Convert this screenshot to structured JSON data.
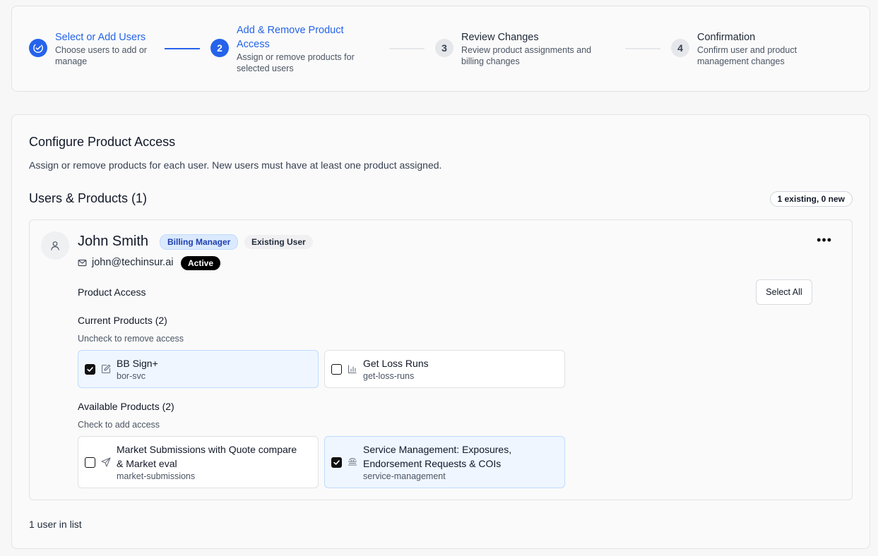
{
  "stepper": {
    "steps": [
      {
        "number": "",
        "title": "Select or Add Users",
        "desc": "Choose users to add or manage",
        "state": "done"
      },
      {
        "number": "2",
        "title": "Add & Remove Product Access",
        "desc": "Assign or remove products for selected users",
        "state": "active"
      },
      {
        "number": "3",
        "title": "Review Changes",
        "desc": "Review product assignments and billing changes",
        "state": "todo"
      },
      {
        "number": "4",
        "title": "Confirmation",
        "desc": "Confirm user and product management changes",
        "state": "todo"
      }
    ]
  },
  "main": {
    "title": "Configure Product Access",
    "subtitle": "Assign or remove products for each user. New users must have at least one product assigned.",
    "section_title": "Users & Products (1)",
    "summary_badge": "1 existing, 0 new",
    "footer": "1 user in list"
  },
  "user": {
    "name": "John Smith",
    "role": "Billing Manager",
    "type": "Existing User",
    "email": "john@techinsur.ai",
    "status": "Active",
    "menu_icon": "more-horizontal-icon"
  },
  "product_access": {
    "title": "Product Access",
    "select_all": "Select All",
    "current": {
      "title": "Current Products (2)",
      "hint": "Uncheck to remove access",
      "items": [
        {
          "name": "BB Sign+",
          "slug": "bor-svc",
          "checked": true,
          "icon": "edit-icon"
        },
        {
          "name": "Get Loss Runs",
          "slug": "get-loss-runs",
          "checked": false,
          "icon": "bar-chart-icon"
        }
      ]
    },
    "available": {
      "title": "Available Products (2)",
      "hint": "Check to add access",
      "items": [
        {
          "name_line1": "Market Submissions with Quote compare",
          "name_line2": "& Market eval",
          "slug": "market-submissions",
          "checked": false,
          "icon": "send-icon"
        },
        {
          "name_line1": "Service Management: Exposures,",
          "name_line2": "Endorsement Requests & COIs",
          "slug": "service-management",
          "checked": true,
          "icon": "stack-icon"
        }
      ]
    }
  },
  "colors": {
    "accent": "#2563eb",
    "selected_bg": "#eff6ff",
    "role_badge_bg": "#dbeafe"
  }
}
